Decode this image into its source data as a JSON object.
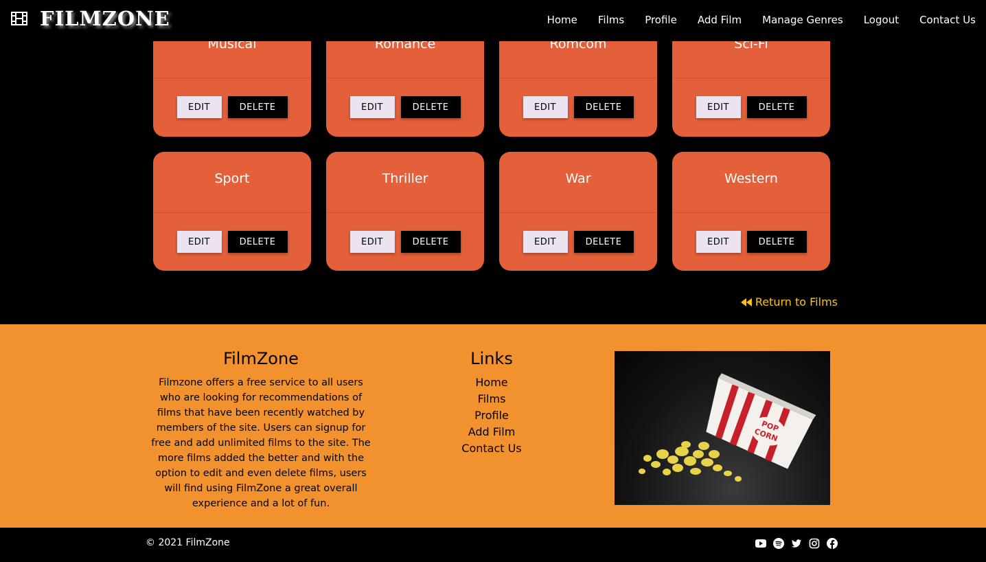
{
  "nav": {
    "brand": "FILMZONE",
    "brand_icon": "film-icon",
    "links": [
      "Home",
      "Films",
      "Profile",
      "Add Film",
      "Manage Genres",
      "Logout",
      "Contact Us"
    ]
  },
  "genres": [
    {
      "name": "Musical",
      "edit": "EDIT",
      "delete": "DELETE"
    },
    {
      "name": "Romance",
      "edit": "EDIT",
      "delete": "DELETE"
    },
    {
      "name": "Romcom",
      "edit": "EDIT",
      "delete": "DELETE"
    },
    {
      "name": "Sci-Fi",
      "edit": "EDIT",
      "delete": "DELETE"
    },
    {
      "name": "Sport",
      "edit": "EDIT",
      "delete": "DELETE"
    },
    {
      "name": "Thriller",
      "edit": "EDIT",
      "delete": "DELETE"
    },
    {
      "name": "War",
      "edit": "EDIT",
      "delete": "DELETE"
    },
    {
      "name": "Western",
      "edit": "EDIT",
      "delete": "DELETE"
    }
  ],
  "return_link": {
    "label": "Return to Films",
    "icon": "backward-icon"
  },
  "footer": {
    "about_title": "FilmZone",
    "about_text": "Filmzone offers a free service to all users who are looking for recommendations of films that have been recently watched by members of the site. Users can signup for free and add unlimited films to the site. The more films added the better and with the option to edit and even delete films, users will find using FilmZone a great overall experience and a lot of fun.",
    "links_title": "Links",
    "links": [
      "Home",
      "Films",
      "Profile",
      "Add Film",
      "Contact Us"
    ],
    "image_text": [
      "POP",
      "CORN"
    ],
    "copyright": "© 2021 FilmZone",
    "socials": [
      "youtube-icon",
      "spotify-icon",
      "twitter-icon",
      "instagram-icon",
      "facebook-icon"
    ]
  },
  "colors": {
    "card": "#e4603a",
    "footer": "#f2922e",
    "return_link": "#f6c21a",
    "edit_button": "#ebe3f0",
    "delete_button": "#000000"
  }
}
